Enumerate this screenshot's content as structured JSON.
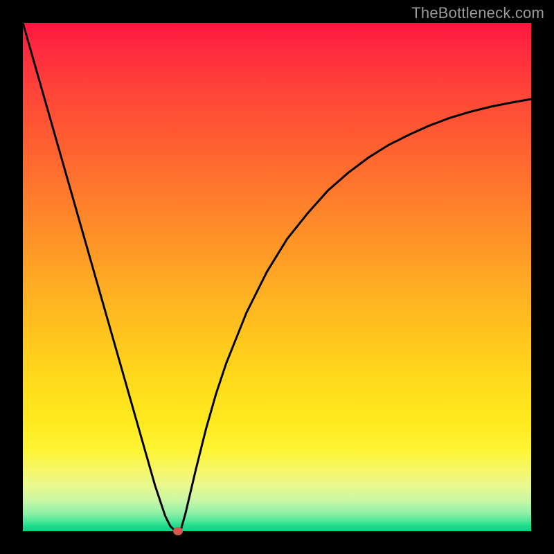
{
  "watermark": "TheBottleneck.com",
  "chart_data": {
    "type": "line",
    "title": "",
    "xlabel": "",
    "ylabel": "",
    "xlim": [
      0,
      100
    ],
    "ylim": [
      0,
      100
    ],
    "grid": false,
    "legend": false,
    "background_gradient": {
      "top": "#ff1740",
      "middle": "#ffda1c",
      "bottom": "#00d684"
    },
    "series": [
      {
        "name": "bottleneck-curve",
        "color": "#000000",
        "x": [
          0,
          2,
          4,
          6,
          8,
          10,
          12,
          14,
          16,
          18,
          20,
          22,
          24,
          26,
          28,
          29,
          30,
          31,
          32,
          34,
          36,
          38,
          40,
          44,
          48,
          52,
          56,
          60,
          64,
          68,
          72,
          76,
          80,
          84,
          88,
          92,
          96,
          100
        ],
        "y": [
          100,
          93,
          86,
          79,
          72,
          65,
          58,
          51,
          44,
          37,
          30,
          23,
          16,
          9,
          3,
          1,
          0,
          0,
          3.5,
          12,
          20,
          27,
          33,
          43,
          51,
          57.5,
          62.5,
          67,
          70.5,
          73.5,
          76,
          78,
          79.8,
          81.3,
          82.5,
          83.5,
          84.3,
          85
        ]
      }
    ],
    "marker": {
      "name": "optimal-point",
      "x": 30.5,
      "y": 0,
      "color": "#d15a4f"
    }
  }
}
